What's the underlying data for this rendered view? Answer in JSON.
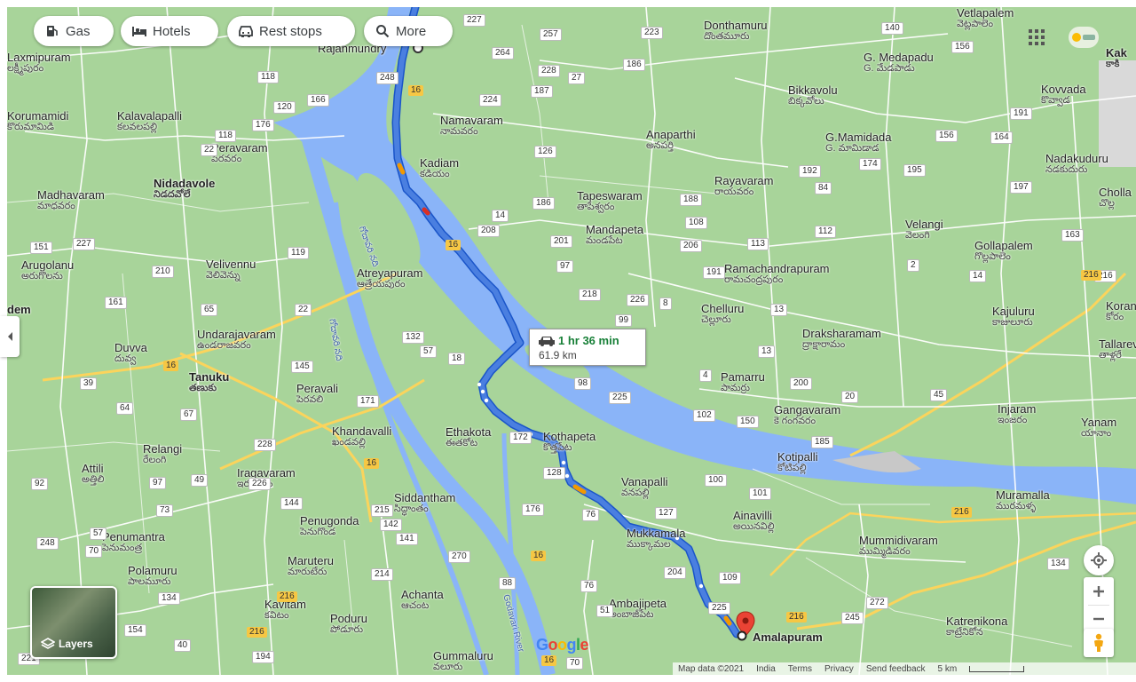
{
  "toolbar": {
    "gas_label": "Gas",
    "hotels_label": "Hotels",
    "rest_stops_label": "Rest stops",
    "more_label": "More"
  },
  "route": {
    "duration": "1 hr 36 min",
    "distance": "61.9 km",
    "origin": "Rajahmundry",
    "destination": "Amalapuram"
  },
  "footer": {
    "map_data": "Map data ©2021",
    "country": "India",
    "terms": "Terms",
    "privacy": "Privacy",
    "feedback": "Send feedback",
    "scale": "5 km"
  },
  "controls": {
    "layers_label": "Layers",
    "google_logo": "Google"
  },
  "colors": {
    "route": "#4a7fe0",
    "river": "#8ab4f8",
    "land": "#a8d49a",
    "marker": "#ea4335"
  },
  "places": [
    {
      "id": "donthamuru",
      "name": "Donthamuru",
      "sub": "దొంతమూరు"
    },
    {
      "id": "vetlapalem",
      "name": "Vetlapalem",
      "sub": "వెట్లపాలెం"
    },
    {
      "id": "kakinada",
      "name": "Kak",
      "sub": "కాకి"
    },
    {
      "id": "lakshmipuram",
      "name": "Laxmipuram",
      "sub": "లక్ష్మీపురం"
    },
    {
      "id": "gmedapadu",
      "name": "G. Medapadu",
      "sub": "G. మేడపాడు"
    },
    {
      "id": "bikkavolu",
      "name": "Bikkavolu",
      "sub": "బిక్కవోలు"
    },
    {
      "id": "kovvada",
      "name": "Kovvada",
      "sub": "కొవ్వాడ"
    },
    {
      "id": "korumamidi",
      "name": "Korumamidi",
      "sub": "కొరుమామిడి"
    },
    {
      "id": "kalavalapalli",
      "name": "Kalavalapalli",
      "sub": "కలవలపల్లి"
    },
    {
      "id": "namavaram",
      "name": "Namavaram",
      "sub": "నామవరం"
    },
    {
      "id": "anaparthi",
      "name": "Anaparthi",
      "sub": "అనపర్తి"
    },
    {
      "id": "gmamidada",
      "name": "G.Mamidada",
      "sub": "G. మామిడాడ"
    },
    {
      "id": "nadakuduru",
      "name": "Nadakuduru",
      "sub": "నడకుదురు"
    },
    {
      "id": "peravaram",
      "name": "Peravaram",
      "sub": "పేరవరం"
    },
    {
      "id": "kadiam",
      "name": "Kadiam",
      "sub": "కడియం"
    },
    {
      "id": "rayavaram",
      "name": "Rayavaram",
      "sub": "రాయవరం"
    },
    {
      "id": "nidadavole",
      "name": "Nidadavole",
      "sub": "నిడదవోలే"
    },
    {
      "id": "madhavaram",
      "name": "Madhavaram",
      "sub": "మాధవరం"
    },
    {
      "id": "tapeswaram",
      "name": "Tapeswaram",
      "sub": "తాపేశ్వరం"
    },
    {
      "id": "mandapeta",
      "name": "Mandapeta",
      "sub": "మండపేట"
    },
    {
      "id": "velangi",
      "name": "Velangi",
      "sub": "వెలంగి"
    },
    {
      "id": "gollapalem",
      "name": "Gollapalem",
      "sub": "గొల్లపాలెం"
    },
    {
      "id": "cholla",
      "name": "Cholla",
      "sub": "చొల్ల"
    },
    {
      "id": "arugolanu",
      "name": "Arugolanu",
      "sub": "అరుగొలను"
    },
    {
      "id": "velivennu",
      "name": "Velivennu",
      "sub": "వెలివెన్ను"
    },
    {
      "id": "atreyapuram",
      "name": "Atreyapuram",
      "sub": "ఆత్రేయపురం"
    },
    {
      "id": "ramachandrapuram",
      "name": "Ramachandrapuram",
      "sub": "రామచంద్రపురం"
    },
    {
      "id": "undarajavaram",
      "name": "Undarajavaram",
      "sub": "ఉండరాజవరం"
    },
    {
      "id": "chelluru",
      "name": "Chelluru",
      "sub": "చెల్లూరు"
    },
    {
      "id": "kajuluru",
      "name": "Kajuluru",
      "sub": "కాజులూరు"
    },
    {
      "id": "korangi",
      "name": "Koran",
      "sub": "కోరం"
    },
    {
      "id": "duvva",
      "name": "Duvva",
      "sub": "దువ్వ"
    },
    {
      "id": "draksharamam",
      "name": "Draksharamam",
      "sub": "ద్రాక్షారామం"
    },
    {
      "id": "tallarevu",
      "name": "Tallarev",
      "sub": "తాళ్లరే"
    },
    {
      "id": "tanuku",
      "name": "Tanuku",
      "sub": "తణుకు"
    },
    {
      "id": "peravali",
      "name": "Peravali",
      "sub": "పెరవలి"
    },
    {
      "id": "pamarru",
      "name": "Pamarru",
      "sub": "పామర్రు"
    },
    {
      "id": "injaram",
      "name": "Injaram",
      "sub": "ఇంజరం"
    },
    {
      "id": "yanam",
      "name": "Yanam",
      "sub": "యానాం"
    },
    {
      "id": "khandavalli",
      "name": "Khandavalli",
      "sub": "ఖండవల్లి"
    },
    {
      "id": "ethakota",
      "name": "Ethakota",
      "sub": "ఈతకోట"
    },
    {
      "id": "kothapeta",
      "name": "Kothapeta",
      "sub": "కొత్తపేట"
    },
    {
      "id": "gangavaram",
      "name": "Gangavaram",
      "sub": "కె గంగవరం"
    },
    {
      "id": "relangi",
      "name": "Relangi",
      "sub": "రేలంగి"
    },
    {
      "id": "kotipalli",
      "name": "Kotipalli",
      "sub": "కోటిపల్లి"
    },
    {
      "id": "attili",
      "name": "Attili",
      "sub": "అత్తిలి"
    },
    {
      "id": "iragavaram",
      "name": "Iragavaram",
      "sub": "ఇరగవరం"
    },
    {
      "id": "vanapalli",
      "name": "Vanapalli",
      "sub": "వనపల్లి"
    },
    {
      "id": "siddantham",
      "name": "Siddantham",
      "sub": "సిద్ధాంతం"
    },
    {
      "id": "muramalla",
      "name": "Muramalla",
      "sub": "మురమళ్ళ"
    },
    {
      "id": "ainavilli",
      "name": "Ainavilli",
      "sub": "అయినవిల్లి"
    },
    {
      "id": "penugonda",
      "name": "Penugonda",
      "sub": "పెనుగొండ"
    },
    {
      "id": "penumantra",
      "name": "Penumantra",
      "sub": "పెనుమంత్ర"
    },
    {
      "id": "mukkamala",
      "name": "Mukkamala",
      "sub": "ముక్కామల"
    },
    {
      "id": "mummidivaram",
      "name": "Mummidivaram",
      "sub": "ముమ్మిడివరం"
    },
    {
      "id": "maruteru",
      "name": "Maruteru",
      "sub": "మారుటేరు"
    },
    {
      "id": "polamuru",
      "name": "Polamuru",
      "sub": "పాలమూరు"
    },
    {
      "id": "achanta",
      "name": "Achanta",
      "sub": "ఆచంట"
    },
    {
      "id": "ambajipeta",
      "name": "Ambajipeta",
      "sub": "అంబాజీపేట"
    },
    {
      "id": "katrenikona",
      "name": "Katrenikona",
      "sub": "కాట్రేనికోన"
    },
    {
      "id": "kavitam",
      "name": "Kavitam",
      "sub": "కవిటం"
    },
    {
      "id": "poduru",
      "name": "Poduru",
      "sub": "పోడూరు"
    },
    {
      "id": "gummaluru",
      "name": "Gummaluru",
      "sub": "వలూరు"
    },
    {
      "id": "nidadem",
      "name": "dem",
      "sub": ""
    },
    {
      "id": "rajahmundry",
      "name": "Rajahmundry",
      "sub": ""
    },
    {
      "id": "godavari1",
      "name": "గోదావరి నది",
      "sub": ""
    },
    {
      "id": "godavari2",
      "name": "గోదావరి నది",
      "sub": ""
    },
    {
      "id": "godavari3",
      "name": "Godavari River",
      "sub": ""
    }
  ],
  "shields": [
    "227",
    "257",
    "223",
    "140",
    "156",
    "264",
    "228",
    "27",
    "186",
    "118",
    "120",
    "166",
    "248",
    "224",
    "187",
    "118",
    "176",
    "22",
    "156",
    "164",
    "191",
    "126",
    "174",
    "195",
    "192",
    "84",
    "197",
    "14",
    "186",
    "108",
    "208",
    "201",
    "188",
    "206",
    "112",
    "113",
    "163",
    "151",
    "227",
    "210",
    "119",
    "97",
    "218",
    "226",
    "191",
    "2",
    "14",
    "216",
    "161",
    "22",
    "65",
    "8",
    "99",
    "13",
    "132",
    "57",
    "18",
    "13",
    "145",
    "4",
    "39",
    "64",
    "67",
    "171",
    "98",
    "225",
    "102",
    "150",
    "200",
    "20",
    "45",
    "185",
    "226",
    "228",
    "172",
    "128",
    "100",
    "101",
    "92",
    "97",
    "49",
    "144",
    "215",
    "142",
    "141",
    "176",
    "76",
    "127",
    "73",
    "57",
    "248",
    "70",
    "134",
    "270",
    "88",
    "214",
    "76",
    "204",
    "109",
    "134",
    "154",
    "40",
    "51",
    "225",
    "245",
    "272",
    "221",
    "194",
    "70",
    "137"
  ],
  "highways": [
    "16",
    "16",
    "16",
    "16",
    "16",
    "216",
    "216",
    "216",
    "216",
    "216",
    "16"
  ]
}
